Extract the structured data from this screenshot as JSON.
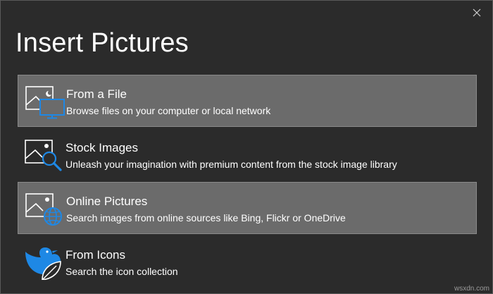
{
  "dialog": {
    "title": "Insert Pictures",
    "close_symbol": "×"
  },
  "options": [
    {
      "label": "From a File",
      "description": "Browse files on your computer or local network",
      "icon": "picture-monitor-icon",
      "highlighted": true
    },
    {
      "label": "Stock Images",
      "description": "Unleash your imagination with premium content from the stock image library",
      "icon": "picture-search-icon",
      "highlighted": false
    },
    {
      "label": "Online Pictures",
      "description": "Search images from online sources like Bing, Flickr or OneDrive",
      "icon": "picture-globe-icon",
      "highlighted": true
    },
    {
      "label": "From Icons",
      "description": "Search the icon collection",
      "icon": "bird-leaf-icon",
      "highlighted": false
    }
  ],
  "watermark": "wsxdn.com",
  "colors": {
    "background": "#2b2b2b",
    "highlight": "#6b6b6b",
    "accent_blue": "#1e88e5",
    "icon_outline": "#ffffff"
  }
}
